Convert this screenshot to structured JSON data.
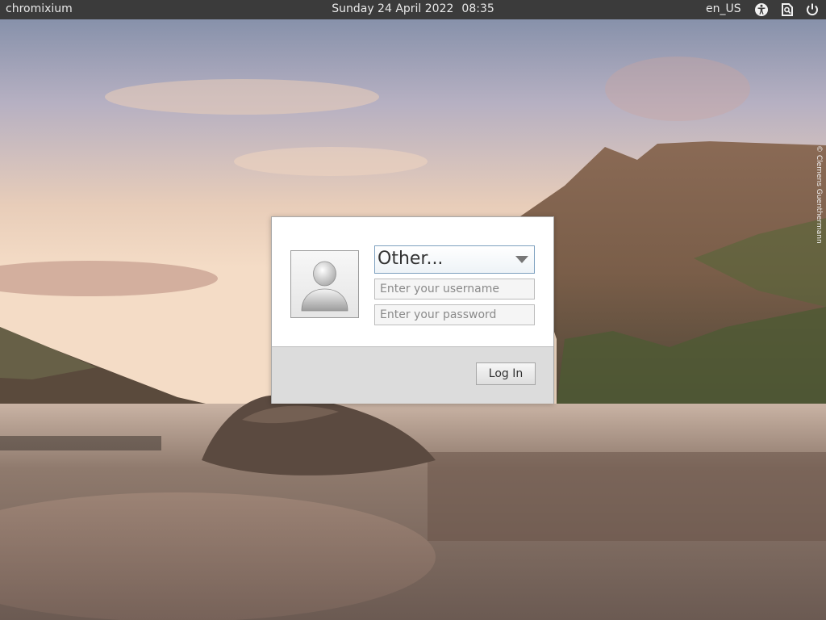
{
  "topbar": {
    "hostname": "chromixium",
    "date": "Sunday 24 April 2022",
    "time": "08:35",
    "language": "en_US",
    "indicators": [
      "accessibility-icon",
      "onboard-keyboard-icon",
      "power-icon"
    ]
  },
  "wallpaper": {
    "credit": "© Clemens Guenthermann"
  },
  "login": {
    "user_selected": "Other...",
    "username_placeholder": "Enter your username",
    "password_placeholder": "Enter your password",
    "login_label": "Log In",
    "avatar_icon": "default-user-icon"
  },
  "colors": {
    "topbar_bg": "#3b3b3b",
    "dialog_bg": "#ffffff",
    "dialog_footer_bg": "#dcdcdc",
    "select_border": "#7da0bf"
  }
}
